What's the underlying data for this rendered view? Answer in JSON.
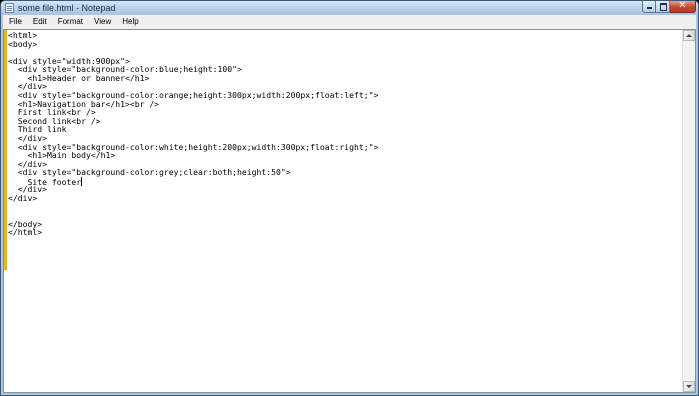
{
  "window": {
    "title": "some file.html - Notepad"
  },
  "menu": [
    "File",
    "Edit",
    "Format",
    "View",
    "Help"
  ],
  "editor": {
    "lines": [
      "<html>",
      "<body>",
      "",
      "<div style=\"width:900px\">",
      "  <div style=\"background-color:blue;height:100\">",
      "    <h1>Header or banner</h1>",
      "  </div>",
      "  <div style=\"background-color:orange;height:300px;width:200px;float:left;\">",
      "  <h1>Navigation bar</h1><br />",
      "  First link<br />",
      "  Second link<br />",
      "  Third link",
      "  </div>",
      "  <div style=\"background-color:white;height:200px;width:300px;float:right;\">",
      "    <h1>Main body</h1>",
      "  </div>",
      "  <div style=\"background-color:grey;clear:both;height:50\">",
      "    Site footer",
      "  </div>",
      "</div>",
      "",
      "",
      "</body>",
      "</html>"
    ],
    "caret_line": 17
  },
  "colors": {
    "titlebar": "#b9d2ec",
    "close_button": "#c9452b",
    "editor_background": "#ffffff"
  }
}
